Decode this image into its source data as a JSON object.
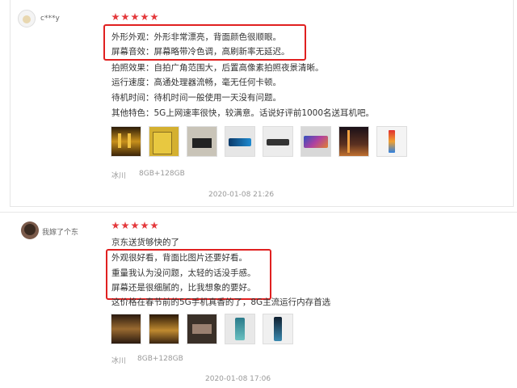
{
  "reviews": [
    {
      "user": "c***y",
      "rating": 5,
      "lines": [
        "外形外观：外形非常漂亮，背面颜色很顺眼。",
        "屏幕音效：屏幕略带冷色调，高刷新率无延迟。",
        "拍照效果：自拍广角范围大，后置高像素拍照夜景清晰。",
        "运行速度：高通处理器流畅，毫无任何卡顿。",
        "待机时间：待机时间一般使用一天没有问题。",
        "其他特色：5G上网速率很快，较满意。话说好评前1000名送耳机吧。"
      ],
      "thumbnails": [
        "photo-1",
        "photo-2",
        "photo-3",
        "photo-4",
        "photo-5",
        "photo-6",
        "photo-7",
        "photo-8"
      ],
      "color": "冰川",
      "spec": "8GB+128GB",
      "date": "2020-01-08 21:26"
    },
    {
      "user": "我嫁了个东",
      "rating": 5,
      "lines": [
        "京东送货够快的了",
        "外观很好看，背面比图片还要好看。",
        "重量我认为没问题，太轻的话没手感。",
        "屏幕还是很细腻的，比我想象的要好。",
        "这价格在春节前的5G手机真香的了，8G主流运行内存首选"
      ],
      "thumbnails": [
        "photo-1",
        "photo-2",
        "photo-3",
        "photo-4",
        "photo-5"
      ],
      "color": "冰川",
      "spec": "8GB+128GB",
      "date": "2020-01-08 17:06"
    }
  ],
  "colors": {
    "star": "#e4393c",
    "highlight": "#e02020"
  }
}
